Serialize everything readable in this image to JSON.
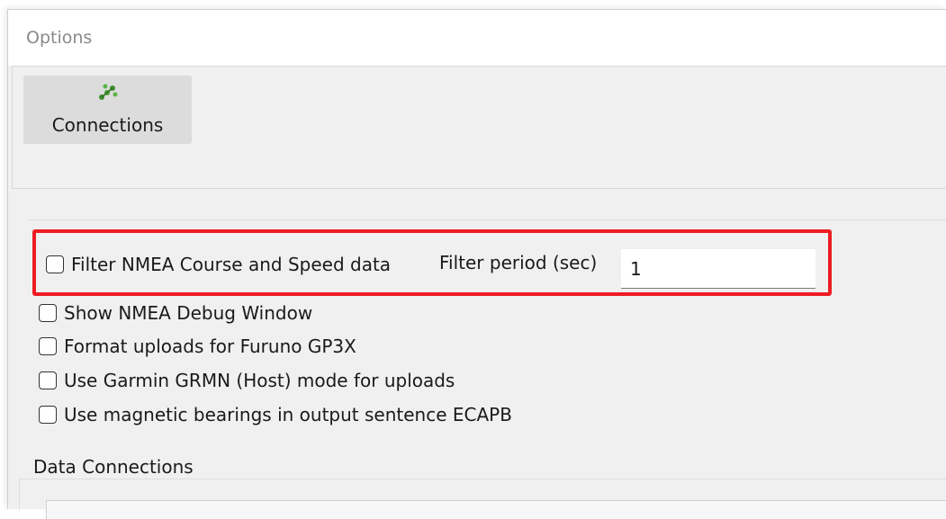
{
  "window": {
    "title": "Options"
  },
  "toolbar": {
    "connections_label": "Connections",
    "connections_icon": "connections-icon"
  },
  "options": {
    "filter_nmea_label": "Filter NMEA Course and Speed data",
    "filter_period_label": "Filter period (sec)",
    "filter_period_value": "1",
    "show_debug_label": "Show NMEA Debug Window",
    "format_furuno_label": "Format uploads for Furuno GP3X",
    "garmin_host_label": "Use Garmin GRMN (Host) mode for uploads",
    "magnetic_bearings_label": "Use magnetic bearings in output sentence ECAPB"
  },
  "data_connections": {
    "label": "Data Connections"
  },
  "colors": {
    "highlight": "#ee1c24",
    "window_bg": "#f0f0f0",
    "button_bg": "#dcdcdc"
  }
}
